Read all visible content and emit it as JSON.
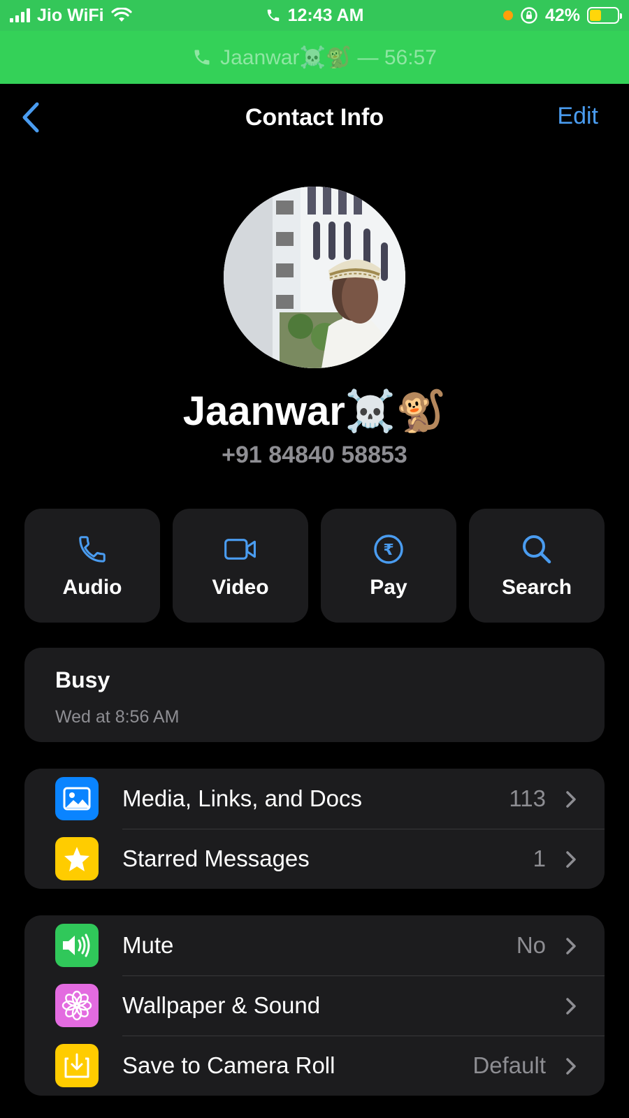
{
  "status_bar": {
    "carrier": "Jio WiFi",
    "time": "12:43 AM",
    "battery": "42%",
    "battery_level": 0.42
  },
  "call_banner": {
    "text": "Jaanwar☠️🐒 — 56:57"
  },
  "nav": {
    "title": "Contact Info",
    "edit_label": "Edit"
  },
  "contact": {
    "name": "Jaanwar☠️🐒",
    "phone": "+91 84840 58853"
  },
  "actions": [
    {
      "label": "Audio",
      "icon": "phone-icon"
    },
    {
      "label": "Video",
      "icon": "video-camera-icon"
    },
    {
      "label": "Pay",
      "icon": "rupee-icon"
    },
    {
      "label": "Search",
      "icon": "search-icon"
    }
  ],
  "status": {
    "text": "Busy",
    "time": "Wed at 8:56 AM"
  },
  "group1": [
    {
      "label": "Media, Links, and Docs",
      "value": "113",
      "icon": "photo-icon",
      "color": "#0a84ff"
    },
    {
      "label": "Starred Messages",
      "value": "1",
      "icon": "star-icon",
      "color": "#ffcc00"
    }
  ],
  "group2": [
    {
      "label": "Mute",
      "value": "No",
      "icon": "speaker-icon",
      "color": "#30c85a"
    },
    {
      "label": "Wallpaper & Sound",
      "value": "",
      "icon": "flower-icon",
      "color": "#e36be0"
    },
    {
      "label": "Save to Camera Roll",
      "value": "Default",
      "icon": "download-icon",
      "color": "#ffcc00"
    }
  ],
  "colors": {
    "status_bar_bg": "#34c759",
    "accent_blue": "#4a9cf0",
    "card_bg": "#1c1c1e",
    "secondary_text": "#8e8e93"
  }
}
